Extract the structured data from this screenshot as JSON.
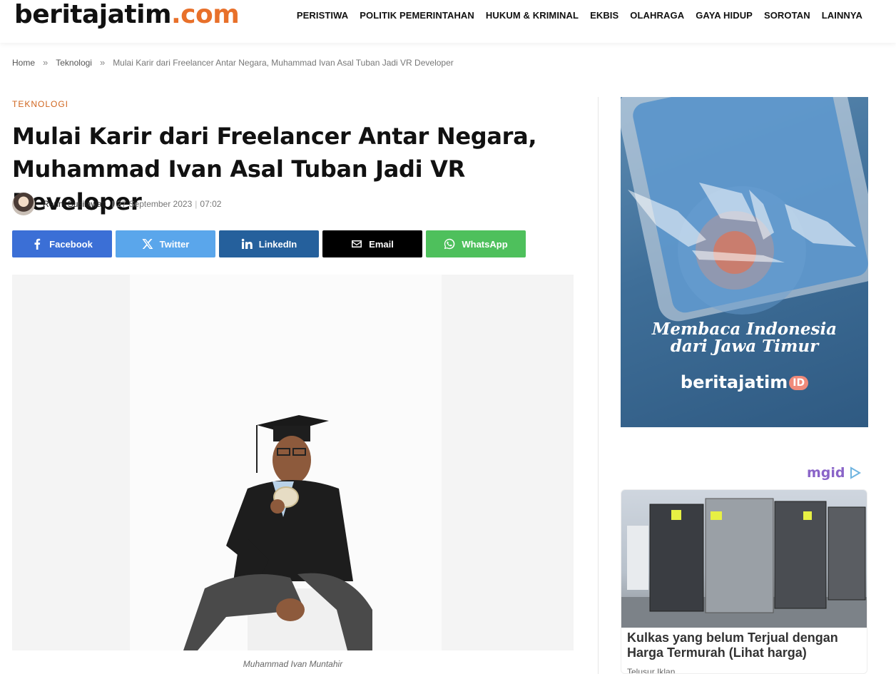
{
  "header": {
    "logo_main": "beritajatim",
    "logo_suffix": ".com",
    "nav": [
      "PERISTIWA",
      "POLITIK PEMERINTAHAN",
      "HUKUM & KRIMINAL",
      "EKBIS",
      "OLAHRAGA",
      "GAYA HIDUP",
      "SOROTAN",
      "LAINNYA"
    ]
  },
  "breadcrumb": {
    "home": "Home",
    "category": "Teknologi",
    "current": "Mulai Karir dari Freelancer Antar Negara, Muhammad Ivan Asal Tuban Jadi VR Developer",
    "separator": "»"
  },
  "article": {
    "category": "TEKNOLOGI",
    "title": "Mulai Karir dari Freelancer Antar Negara, Muhammad Ivan Asal Tuban Jadi VR Developer",
    "author": "Renni Susilawati",
    "date": "27 September 2023",
    "time": "07:02",
    "caption": "Muhammad Ivan Muntahir"
  },
  "share": [
    {
      "label": "Facebook",
      "icon": "facebook-icon",
      "color": "#3b6fd6"
    },
    {
      "label": "Twitter",
      "icon": "x-icon",
      "color": "#5aa6eb"
    },
    {
      "label": "LinkedIn",
      "icon": "linkedin-icon",
      "color": "#25609c"
    },
    {
      "label": "Email",
      "icon": "email-icon",
      "color": "#000000"
    },
    {
      "label": "WhatsApp",
      "icon": "whatsapp-icon",
      "color": "#4ec05c"
    }
  ],
  "sidebar": {
    "ad1_headline_1": "Membaca Indonesia",
    "ad1_headline_2": "dari Jawa Timur",
    "ad1_brand": "beritajatim",
    "ad1_brand_badge": "ID",
    "ad2_provider": "mgid",
    "ad2_title": "Kulkas yang belum Terjual dengan Harga Termurah (Lihat harga)",
    "ad2_source": "Telusur Iklan"
  },
  "colors": {
    "accent": "#e8702a",
    "category": "#d0651e"
  }
}
